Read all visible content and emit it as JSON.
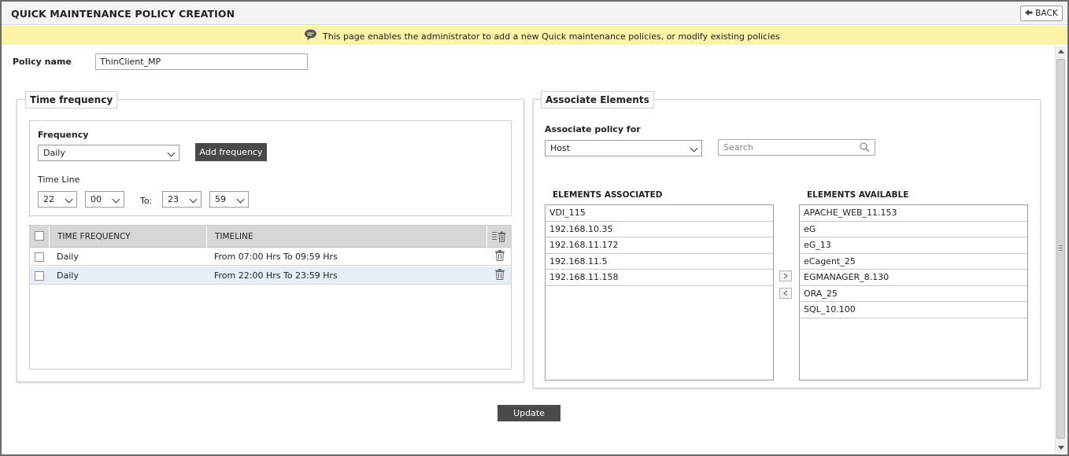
{
  "page": {
    "title": "QUICK MAINTENANCE POLICY CREATION",
    "back_label": "BACK",
    "info_message": "This page enables the administrator to add a new Quick maintenance policies, or modify existing policies"
  },
  "policy": {
    "label": "Policy name",
    "value": "ThinClient_MP"
  },
  "time_frequency": {
    "legend": "Time frequency",
    "frequency_label": "Frequency",
    "frequency_value": "Daily",
    "add_button": "Add frequency",
    "timeline_label": "Time Line",
    "from_hour": "22",
    "from_min": "00",
    "to_label": "To:",
    "to_hour": "23",
    "to_min": "59",
    "table": {
      "headers": [
        "TIME FREQUENCY",
        "TIMELINE"
      ],
      "rows": [
        {
          "frequency": "Daily",
          "timeline": "From 07:00 Hrs To 09:59 Hrs"
        },
        {
          "frequency": "Daily",
          "timeline": "From 22:00 Hrs To 23:59 Hrs"
        }
      ]
    }
  },
  "associate": {
    "legend": "Associate Elements",
    "for_label": "Associate policy for",
    "for_value": "Host",
    "search_placeholder": "Search",
    "associated_title": "ELEMENTS ASSOCIATED",
    "available_title": "ELEMENTS AVAILABLE",
    "associated": [
      "VDI_115",
      "192.168.10.35",
      "192.168.11.172",
      "192.168.11.5",
      "192.168.11.158"
    ],
    "available": [
      "APACHE_WEB_11.153",
      "eG",
      "eG_13",
      "eCagent_25",
      "EGMANAGER_8.130",
      "ORA_25",
      "SQL_10.100"
    ]
  },
  "update_label": "Update",
  "colors": {
    "info_bar": "#fbf3a5",
    "button_dark": "#4a4a4a",
    "grid_header": "#d7d7d7",
    "selected_row": "#e6eef7"
  },
  "icons": [
    "back-arrow-icon",
    "speech-bubble-icon",
    "chevron-down-icon",
    "trash-icon",
    "delete-all-icon",
    "search-icon",
    "move-right-icon",
    "move-left-icon"
  ]
}
